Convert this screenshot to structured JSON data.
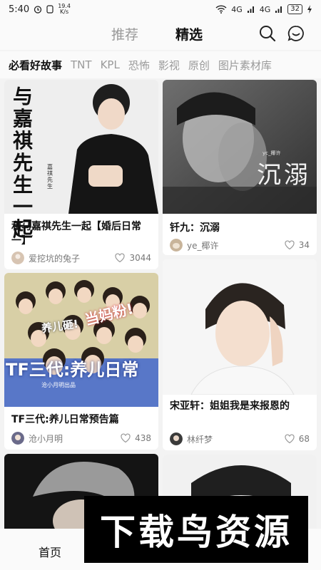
{
  "status": {
    "time": "5:40",
    "net_speed": "19.4\nK/s",
    "network_a": "4G",
    "network_b": "4G",
    "battery": "32"
  },
  "top_tabs": {
    "recommend": "推荐",
    "featured": "精选"
  },
  "categories": [
    "必看好故事",
    "TNT",
    "KPL",
    "恐怖",
    "影视",
    "原创",
    "图片素材库"
  ],
  "cards": [
    {
      "cover_text": "与嘉祺先生一起",
      "cover_small": "嘉祺先生",
      "title": "和马嘉祺先生一起【婚后日常一】",
      "author": "爱挖坑的兔子",
      "likes": "3044"
    },
    {
      "cover_text": "沉溺",
      "cover_small": "yc_椰许",
      "title": "钎九：沉溺",
      "author": "ye_椰许",
      "likes": "34"
    },
    {
      "cover_text": "TF三代:养儿日常",
      "cover_badge_1": "当妈粉!",
      "cover_badge_2": "养儿砸!",
      "cover_small": "沧小月明出品",
      "title": "TF三代:养儿日常预告篇",
      "author": "沧小月明",
      "likes": "438"
    },
    {
      "title": "宋亚轩：姐姐我是来报恩的",
      "author": "林纤梦",
      "likes": "68"
    },
    {
      "title": ""
    },
    {
      "title": ""
    }
  ],
  "bottom": {
    "home": "首页"
  },
  "watermark": "下载鸟资源",
  "colors": {
    "accent_active": "#111111",
    "muted": "#9a9a9a",
    "bg": "#f3f3f3"
  }
}
